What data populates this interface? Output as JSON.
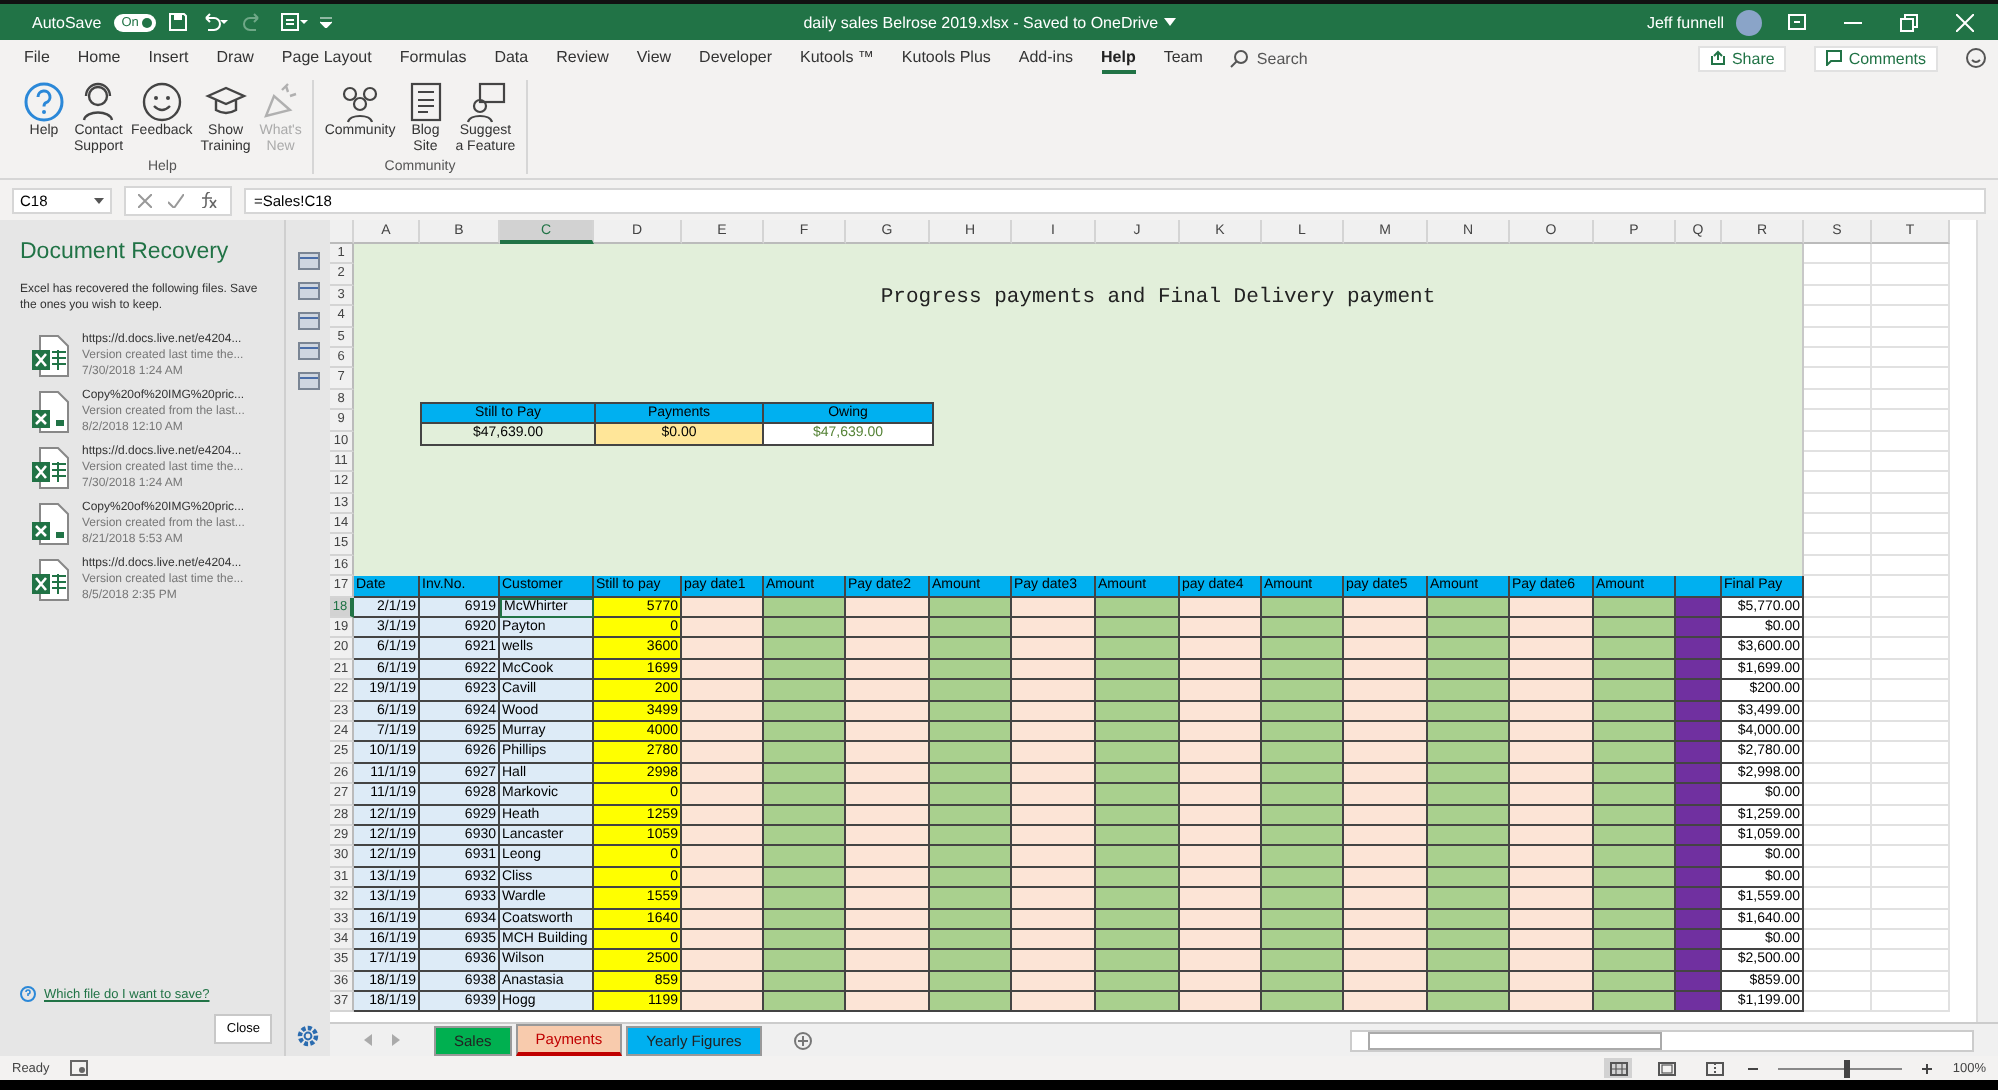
{
  "title_bar": {
    "autosave_label": "AutoSave",
    "autosave": {
      "on": true,
      "label": "On"
    },
    "document_title": "daily sales Belrose 2019.xlsx  -  Saved to OneDrive",
    "user": "Jeff funnell"
  },
  "ribbon": {
    "tabs": [
      {
        "label": "File",
        "selected": false
      },
      {
        "label": "Home",
        "selected": false
      },
      {
        "label": "Insert",
        "selected": false
      },
      {
        "label": "Draw",
        "selected": false
      },
      {
        "label": "Page Layout",
        "selected": false
      },
      {
        "label": "Formulas",
        "selected": false
      },
      {
        "label": "Data",
        "selected": false
      },
      {
        "label": "Review",
        "selected": false
      },
      {
        "label": "View",
        "selected": false
      },
      {
        "label": "Developer",
        "selected": false
      },
      {
        "label": "Kutools ™",
        "selected": false
      },
      {
        "label": "Kutools Plus",
        "selected": false
      },
      {
        "label": "Add-ins",
        "selected": false
      },
      {
        "label": "Help",
        "selected": true
      },
      {
        "label": "Team",
        "selected": false
      }
    ],
    "search": {
      "placeholder": "Search"
    },
    "share": "Share",
    "comments": "Comments",
    "groups": [
      {
        "label": "Help",
        "buttons": [
          {
            "label": "Help",
            "kind": "help",
            "disabled": false
          },
          {
            "label": "Contact\nSupport",
            "kind": "support",
            "disabled": false
          },
          {
            "label": "Feedback",
            "kind": "feedback",
            "disabled": false
          },
          {
            "label": "Show\nTraining",
            "kind": "training",
            "disabled": false
          },
          {
            "label": "What's\nNew",
            "kind": "news",
            "disabled": true
          }
        ]
      },
      {
        "label": "Community",
        "buttons": [
          {
            "label": "Community",
            "kind": "community",
            "disabled": false
          },
          {
            "label": "Blog\nSite",
            "kind": "blog",
            "disabled": false
          },
          {
            "label": "Suggest\na Feature",
            "kind": "suggest",
            "disabled": false
          }
        ]
      }
    ]
  },
  "formula_bar": {
    "name_box": "C18",
    "formula": "=Sales!C18"
  },
  "recovery": {
    "title": "Document Recovery",
    "description": "Excel has recovered the following files.  Save the ones you wish to keep.",
    "files": [
      {
        "name": "https://d.docs.live.net/e4204...",
        "note": "Version created last time the...",
        "date": "7/30/2018 1:24 AM",
        "kind": "workbook"
      },
      {
        "name": "Copy%20of%20IMG%20pric...",
        "note": "Version created from the last...",
        "date": "8/2/2018 12:10 AM",
        "kind": "copy"
      },
      {
        "name": "https://d.docs.live.net/e4204...",
        "note": "Version created last time the...",
        "date": "7/30/2018 1:24 AM",
        "kind": "workbook"
      },
      {
        "name": "Copy%20of%20IMG%20pric...",
        "note": "Version created from the last...",
        "date": "8/21/2018 5:53 AM",
        "kind": "copy"
      },
      {
        "name": "https://d.docs.live.net/e4204...",
        "note": "Version created last time the...",
        "date": "8/5/2018 2:35 PM",
        "kind": "workbook"
      }
    ],
    "help_link": "Which file do I want to save?",
    "close": "Close"
  },
  "sheet": {
    "title": "Progress payments and Final Delivery payment",
    "summary": {
      "headers": [
        "Still to Pay",
        "Payments",
        "Owing"
      ],
      "values": [
        {
          "text": "$47,639.00",
          "kind": "due"
        },
        {
          "text": "$0.00",
          "kind": "paid"
        },
        {
          "text": "$47,639.00",
          "kind": "owing"
        }
      ]
    },
    "top_rows": [
      "1",
      "2",
      "3",
      "4",
      "5",
      "6",
      "7",
      "8",
      "9",
      "10",
      "11",
      "12",
      "13",
      "14",
      "15",
      "16"
    ],
    "columns": [
      {
        "letter": "A",
        "header": "Date",
        "kind": "date",
        "selected": false
      },
      {
        "letter": "B",
        "header": "Inv.No.",
        "kind": "inv",
        "selected": false
      },
      {
        "letter": "C",
        "header": "Customer",
        "kind": "customer",
        "selected": true
      },
      {
        "letter": "D",
        "header": "Still to pay",
        "kind": "still",
        "selected": false
      },
      {
        "letter": "E",
        "header": "pay date1",
        "kind": "paydate",
        "selected": false
      },
      {
        "letter": "F",
        "header": "Amount",
        "kind": "amount",
        "selected": false
      },
      {
        "letter": "G",
        "header": "Pay date2",
        "kind": "paydate",
        "selected": false
      },
      {
        "letter": "H",
        "header": "Amount",
        "kind": "amount",
        "selected": false
      },
      {
        "letter": "I",
        "header": "Pay date3",
        "kind": "paydate",
        "selected": false
      },
      {
        "letter": "J",
        "header": "Amount",
        "kind": "amount",
        "selected": false
      },
      {
        "letter": "K",
        "header": "pay date4",
        "kind": "paydate",
        "selected": false
      },
      {
        "letter": "L",
        "header": "Amount",
        "kind": "amount",
        "selected": false
      },
      {
        "letter": "M",
        "header": "pay date5",
        "kind": "paydate",
        "selected": false
      },
      {
        "letter": "N",
        "header": "Amount",
        "kind": "amount",
        "selected": false
      },
      {
        "letter": "O",
        "header": "Pay date6",
        "kind": "paydate",
        "selected": false
      },
      {
        "letter": "P",
        "header": "Amount",
        "kind": "amount",
        "selected": false
      },
      {
        "letter": "Q",
        "kind": "marker",
        "selected": false
      },
      {
        "letter": "R",
        "header": "Final Pay",
        "kind": "final",
        "selected": false
      },
      {
        "letter": "S",
        "kind": "blank",
        "selected": false
      },
      {
        "letter": "T",
        "kind": "blank",
        "selected": false
      }
    ],
    "header_row": "17",
    "rows": [
      {
        "row": "18",
        "selected": true,
        "date": "2/1/19",
        "inv": "6919",
        "customer": "McWhirter",
        "still": "5770",
        "final": "$5,770.00"
      },
      {
        "row": "19",
        "selected": false,
        "date": "3/1/19",
        "inv": "6920",
        "customer": "Payton",
        "still": "0",
        "final": "$0.00"
      },
      {
        "row": "20",
        "selected": false,
        "date": "6/1/19",
        "inv": "6921",
        "customer": "wells",
        "still": "3600",
        "final": "$3,600.00"
      },
      {
        "row": "21",
        "selected": false,
        "date": "6/1/19",
        "inv": "6922",
        "customer": "McCook",
        "still": "1699",
        "final": "$1,699.00"
      },
      {
        "row": "22",
        "selected": false,
        "date": "19/1/19",
        "inv": "6923",
        "customer": "Cavill",
        "still": "200",
        "final": "$200.00"
      },
      {
        "row": "23",
        "selected": false,
        "date": "6/1/19",
        "inv": "6924",
        "customer": "Wood",
        "still": "3499",
        "final": "$3,499.00"
      },
      {
        "row": "24",
        "selected": false,
        "date": "7/1/19",
        "inv": "6925",
        "customer": "Murray",
        "still": "4000",
        "final": "$4,000.00"
      },
      {
        "row": "25",
        "selected": false,
        "date": "10/1/19",
        "inv": "6926",
        "customer": "Phillips",
        "still": "2780",
        "final": "$2,780.00"
      },
      {
        "row": "26",
        "selected": false,
        "date": "11/1/19",
        "inv": "6927",
        "customer": "Hall",
        "still": "2998",
        "final": "$2,998.00"
      },
      {
        "row": "27",
        "selected": false,
        "date": "11/1/19",
        "inv": "6928",
        "customer": "Markovic",
        "still": "0",
        "final": "$0.00"
      },
      {
        "row": "28",
        "selected": false,
        "date": "12/1/19",
        "inv": "6929",
        "customer": "Heath",
        "still": "1259",
        "final": "$1,259.00"
      },
      {
        "row": "29",
        "selected": false,
        "date": "12/1/19",
        "inv": "6930",
        "customer": "Lancaster",
        "still": "1059",
        "final": "$1,059.00"
      },
      {
        "row": "30",
        "selected": false,
        "date": "12/1/19",
        "inv": "6931",
        "customer": "Leong",
        "still": "0",
        "final": "$0.00"
      },
      {
        "row": "31",
        "selected": false,
        "date": "13/1/19",
        "inv": "6932",
        "customer": "Cliss",
        "still": "0",
        "final": "$0.00"
      },
      {
        "row": "32",
        "selected": false,
        "date": "13/1/19",
        "inv": "6933",
        "customer": "Wardle",
        "still": "1559",
        "final": "$1,559.00"
      },
      {
        "row": "33",
        "selected": false,
        "date": "16/1/19",
        "inv": "6934",
        "customer": "Coatsworth",
        "still": "1640",
        "final": "$1,640.00"
      },
      {
        "row": "34",
        "selected": false,
        "date": "16/1/19",
        "inv": "6935",
        "customer": "MCH Building",
        "still": "0",
        "final": "$0.00"
      },
      {
        "row": "35",
        "selected": false,
        "date": "17/1/19",
        "inv": "6936",
        "customer": "Wilson",
        "still": "2500",
        "final": "$2,500.00"
      },
      {
        "row": "36",
        "selected": false,
        "date": "18/1/19",
        "inv": "6938",
        "customer": "Anastasia",
        "still": "859",
        "final": "$859.00"
      },
      {
        "row": "37",
        "selected": false,
        "date": "18/1/19",
        "inv": "6939",
        "customer": "Hogg",
        "still": "1199",
        "final": "$1,199.00"
      }
    ]
  },
  "sheet_tabs": [
    {
      "label": "Sales",
      "selected": false,
      "color": "#00b050"
    },
    {
      "label": "Payments",
      "selected": true,
      "color": "#f8cbad"
    },
    {
      "label": "Yearly Figures",
      "selected": false,
      "color": "#00b0f0"
    }
  ],
  "status_bar": {
    "status": "Ready",
    "views": [
      {
        "kind": "normal",
        "selected": true
      },
      {
        "kind": "layout",
        "selected": false
      },
      {
        "kind": "pagebreak",
        "selected": false
      }
    ],
    "zoom": {
      "level": 0.55,
      "label": "100%"
    }
  }
}
